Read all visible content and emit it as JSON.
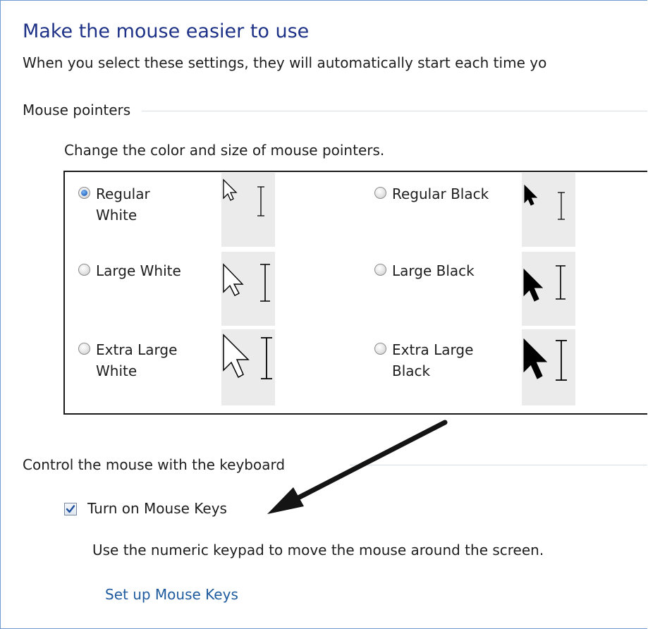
{
  "header": {
    "title": "Make the mouse easier to use",
    "subtitle": "When you select these settings, they will automatically start each time yo"
  },
  "mouse_pointers": {
    "section_label": "Mouse pointers",
    "description": "Change the color and size of mouse pointers.",
    "options": [
      {
        "label_line1": "Regular",
        "label_line2": "White",
        "checked": true
      },
      {
        "label_line1": "Regular Black",
        "label_line2": "",
        "checked": false
      },
      {
        "label_line1": "Large White",
        "label_line2": "",
        "checked": false
      },
      {
        "label_line1": "Large Black",
        "label_line2": "",
        "checked": false
      },
      {
        "label_line1": "Extra Large",
        "label_line2": "White",
        "checked": false
      },
      {
        "label_line1": "Extra Large",
        "label_line2": "Black",
        "checked": false
      }
    ]
  },
  "keyboard": {
    "section_label": "Control the mouse with the keyboard",
    "mouse_keys_label": "Turn on Mouse Keys",
    "mouse_keys_checked": true,
    "mouse_keys_description": "Use the numeric keypad to move the mouse around the screen.",
    "setup_link": "Set up Mouse Keys"
  },
  "colors": {
    "title": "#1e3287",
    "link": "#1d5a9e",
    "frame_border": "#6f9bd1",
    "preview_bg": "#ebebeb"
  }
}
